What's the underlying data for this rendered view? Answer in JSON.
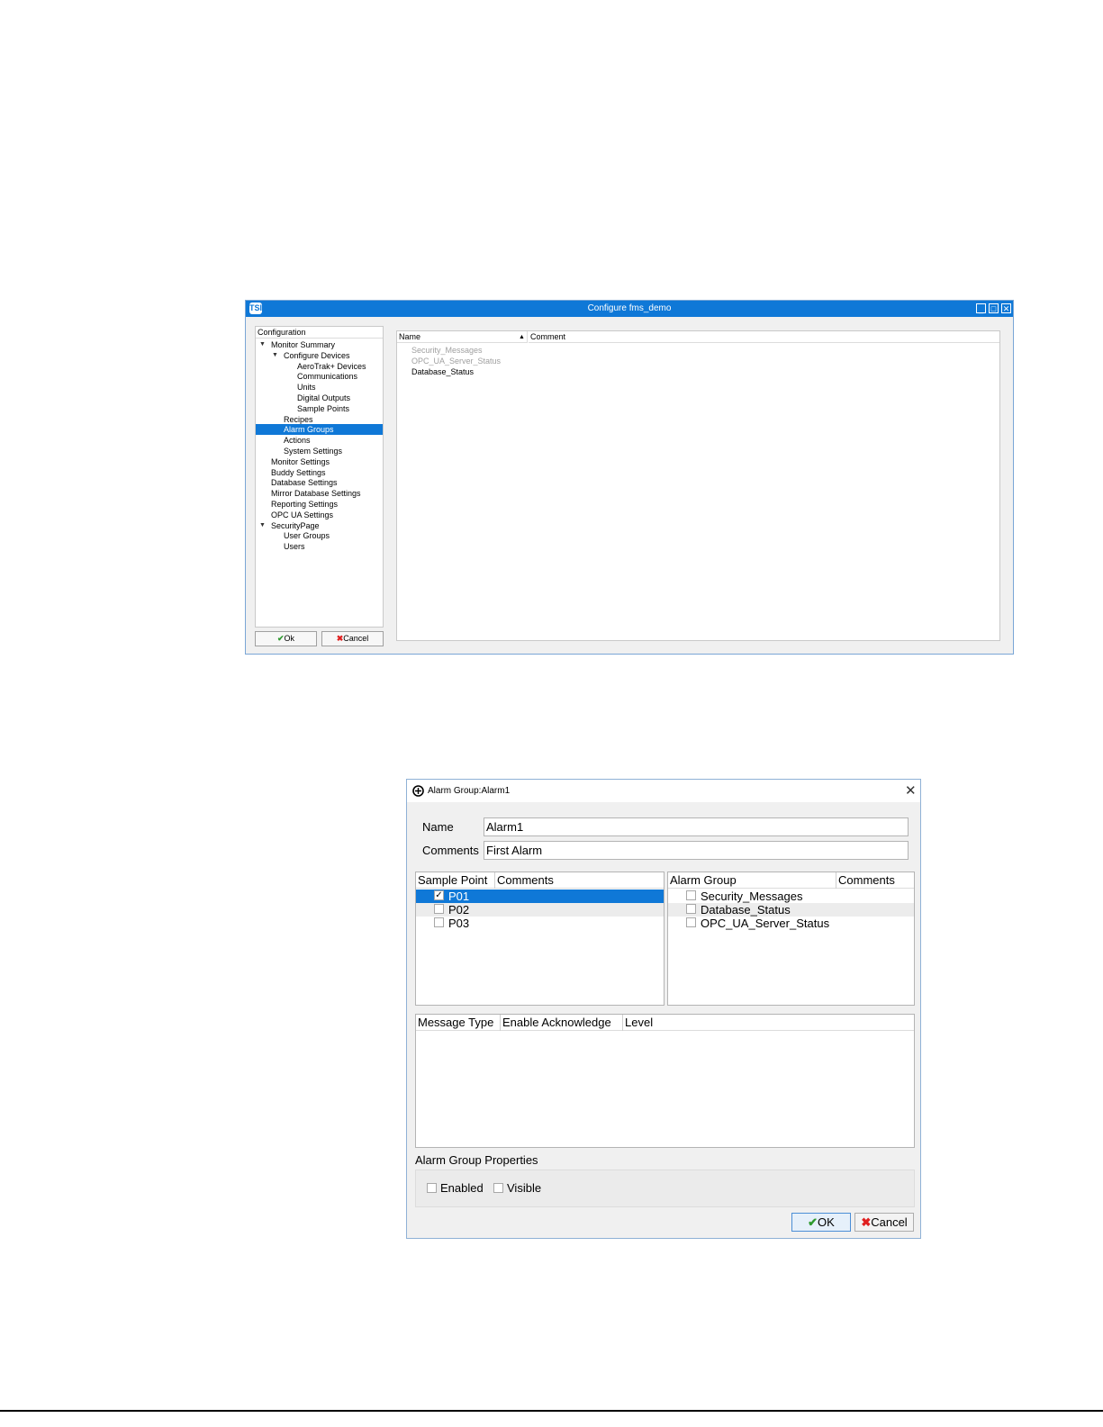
{
  "configure_window": {
    "title": "Configure fms_demo",
    "logo": "TSI",
    "tree_header": "Configuration",
    "tree": [
      {
        "label": "Monitor Summary",
        "expanded": true
      },
      {
        "label": "Configure Devices",
        "expanded": true
      },
      {
        "label": "AeroTrak+ Devices"
      },
      {
        "label": "Communications"
      },
      {
        "label": "Units"
      },
      {
        "label": "Digital Outputs"
      },
      {
        "label": "Sample Points"
      },
      {
        "label": "Recipes"
      },
      {
        "label": "Alarm Groups",
        "selected": true
      },
      {
        "label": "Actions"
      },
      {
        "label": "System Settings"
      },
      {
        "label": "Monitor Settings"
      },
      {
        "label": "Buddy Settings"
      },
      {
        "label": "Database Settings"
      },
      {
        "label": "Mirror Database Settings"
      },
      {
        "label": "Reporting Settings"
      },
      {
        "label": "OPC UA Settings"
      },
      {
        "label": "SecurityPage",
        "expanded": true
      },
      {
        "label": "User Groups"
      },
      {
        "label": "Users"
      }
    ],
    "ok_label": "Ok",
    "cancel_label": "Cancel",
    "list_columns": {
      "name": "Name",
      "comment": "Comment"
    },
    "list_rows": [
      {
        "name": "Security_Messages",
        "disabled": true
      },
      {
        "name": "OPC_UA_Server_Status",
        "disabled": true
      },
      {
        "name": "Database_Status",
        "disabled": false
      }
    ]
  },
  "alarm_dialog": {
    "title": "Alarm Group:Alarm1",
    "name_label": "Name",
    "name_value": "Alarm1",
    "comments_label": "Comments",
    "comments_value": "First Alarm",
    "sample_point_columns": {
      "sample_point": "Sample Point",
      "comments": "Comments"
    },
    "sample_points": [
      {
        "label": "P01",
        "checked": true,
        "selected": true
      },
      {
        "label": "P02",
        "checked": false
      },
      {
        "label": "P03",
        "checked": false
      }
    ],
    "alarm_group_columns": {
      "alarm_group": "Alarm Group",
      "comments": "Comments"
    },
    "alarm_groups": [
      {
        "label": "Security_Messages",
        "checked": false
      },
      {
        "label": "Database_Status",
        "checked": false
      },
      {
        "label": "OPC_UA_Server_Status",
        "checked": false
      }
    ],
    "message_columns": {
      "message_type": "Message Type",
      "enable_ack": "Enable Acknowledge",
      "level": "Level"
    },
    "properties_label": "Alarm Group Properties",
    "enabled_label": "Enabled",
    "visible_label": "Visible",
    "ok_label": "OK",
    "cancel_label": "Cancel"
  },
  "colors": {
    "accent": "#0f78d7",
    "ok_check": "#2e9a2e",
    "cancel_x": "#e02020"
  }
}
